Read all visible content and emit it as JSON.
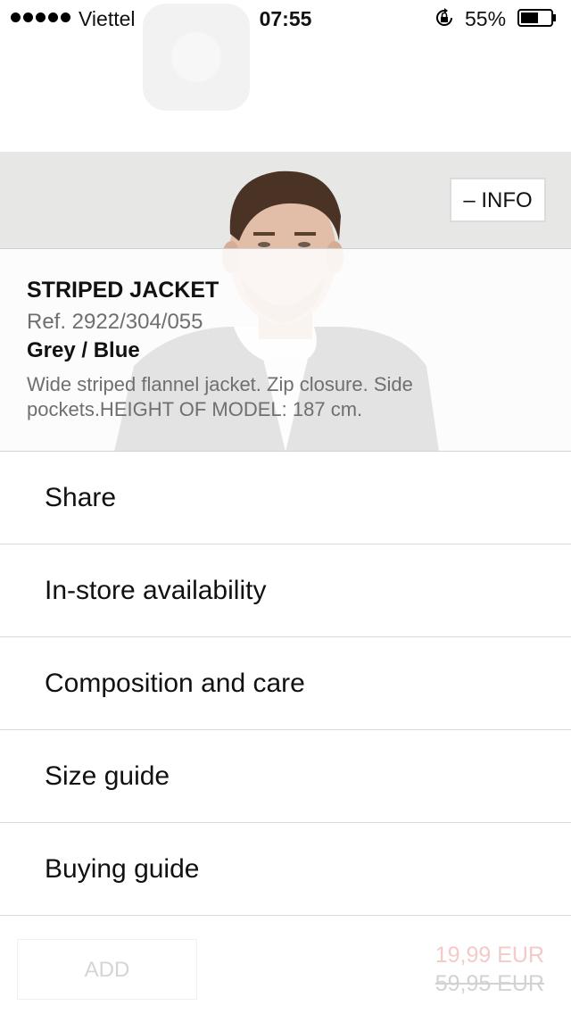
{
  "status_bar": {
    "carrier": "Viettel",
    "time": "07:55",
    "battery": "55%"
  },
  "product": {
    "info_toggle_label": "– INFO",
    "name": "STRIPED JACKET",
    "ref": "Ref. 2922/304/055",
    "color": "Grey / Blue",
    "description": "Wide striped flannel jacket. Zip closure. Side pockets.HEIGHT OF MODEL: 187 cm."
  },
  "menu": {
    "items": [
      {
        "label": "Share"
      },
      {
        "label": "In-store availability"
      },
      {
        "label": "Composition and care"
      },
      {
        "label": "Size guide"
      },
      {
        "label": "Buying guide"
      }
    ]
  },
  "purchase": {
    "add_label": "ADD",
    "sale_price": "19,99 EUR",
    "original_price": "59,95 EUR"
  },
  "icons": {
    "signal": "signal-dots-icon",
    "wifi": "wifi-icon",
    "orientation_lock": "orientation-lock-icon",
    "battery": "battery-icon"
  },
  "colors": {
    "sale_price": "#f4c9c9",
    "muted_text": "#6f6f6f",
    "divider": "#d9d9d9"
  }
}
